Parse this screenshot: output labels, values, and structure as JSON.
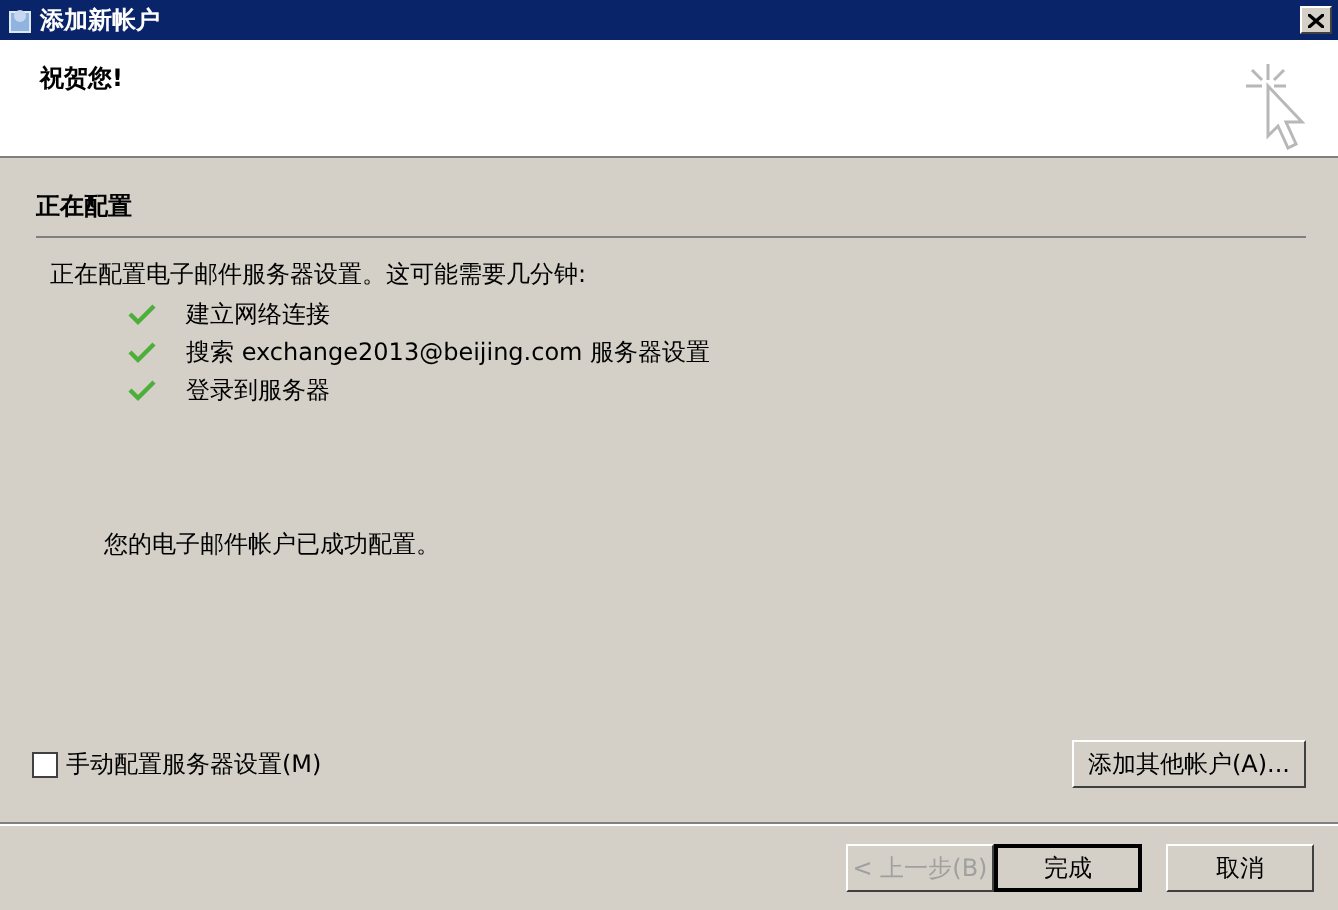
{
  "window": {
    "title": "添加新帐户"
  },
  "header": {
    "title": "祝贺您!"
  },
  "section": {
    "title": "正在配置"
  },
  "intro": "正在配置电子邮件服务器设置。这可能需要几分钟:",
  "steps": [
    {
      "label": "建立网络连接",
      "done": true
    },
    {
      "label": "搜索 exchange2013@beijing.com 服务器设置",
      "done": true
    },
    {
      "label": "登录到服务器",
      "done": true
    }
  ],
  "result": "您的电子邮件帐户已成功配置。",
  "manual_config": {
    "label": "手动配置服务器设置(M)",
    "checked": false
  },
  "add_other_button": "添加其他帐户(A)...",
  "buttons": [
    {
      "label": "< 上一步(B)",
      "disabled": true,
      "default": false
    },
    {
      "label": "完成",
      "disabled": false,
      "default": true
    },
    {
      "label": "取消",
      "disabled": false,
      "default": false
    }
  ]
}
